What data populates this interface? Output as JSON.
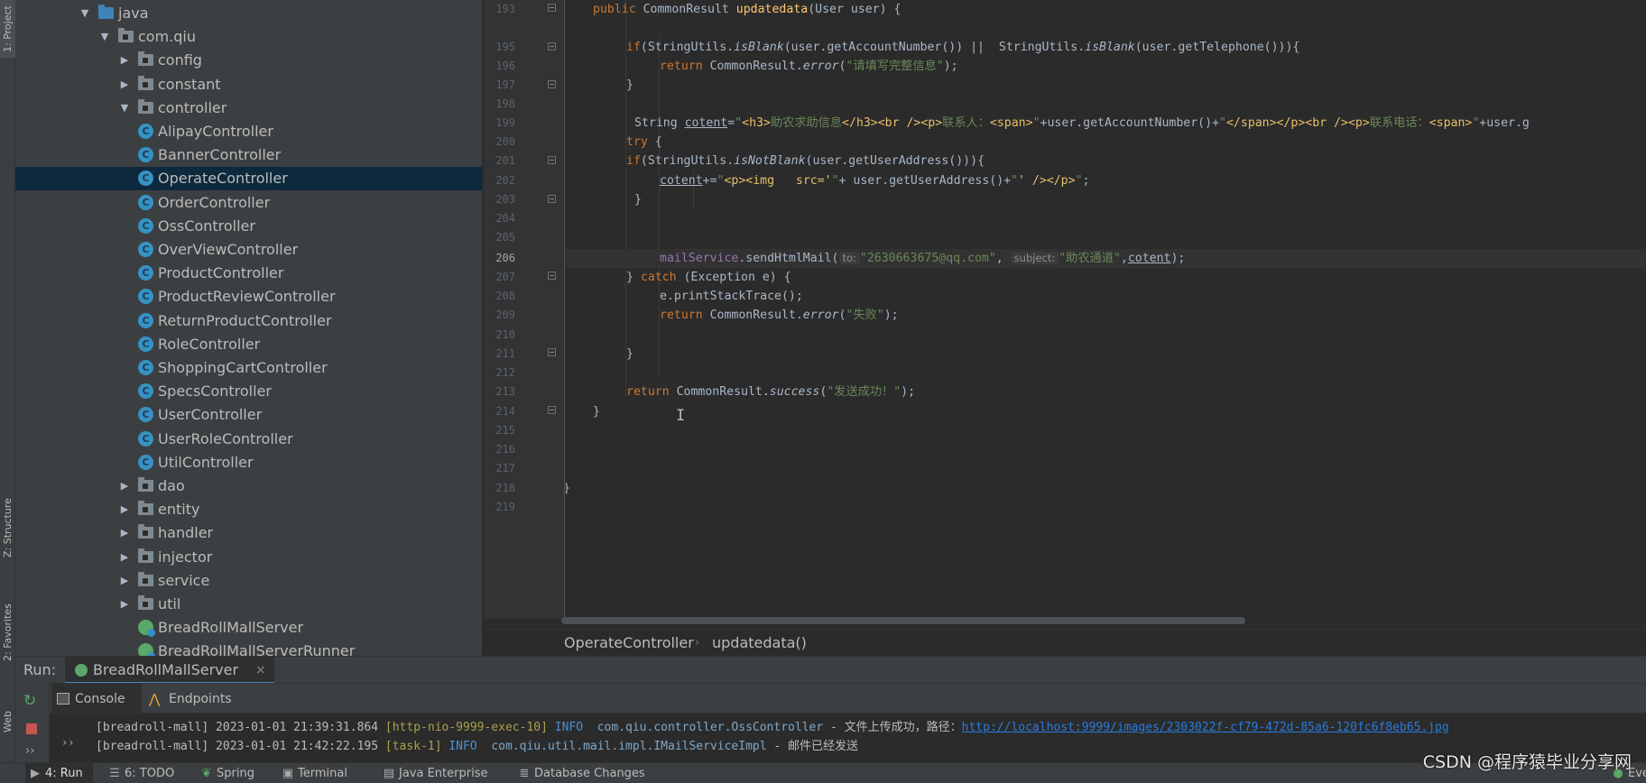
{
  "side_tabs": {
    "project": "1: Project",
    "structure": "Z: Structure",
    "favorites": "2: Favorites",
    "web": "Web"
  },
  "tree": [
    {
      "label": "java",
      "kind": "folder-blue",
      "state": "expanded"
    },
    {
      "label": "com.qiu",
      "kind": "package",
      "state": "expanded"
    },
    {
      "label": "config",
      "kind": "package",
      "state": "collapsed"
    },
    {
      "label": "constant",
      "kind": "package",
      "state": "collapsed"
    },
    {
      "label": "controller",
      "kind": "package",
      "state": "expanded"
    },
    {
      "label": "AlipayController",
      "kind": "class"
    },
    {
      "label": "BannerController",
      "kind": "class"
    },
    {
      "label": "OperateController",
      "kind": "class",
      "selected": true
    },
    {
      "label": "OrderController",
      "kind": "class"
    },
    {
      "label": "OssController",
      "kind": "class"
    },
    {
      "label": "OverViewController",
      "kind": "class"
    },
    {
      "label": "ProductController",
      "kind": "class"
    },
    {
      "label": "ProductReviewController",
      "kind": "class"
    },
    {
      "label": "ReturnProductController",
      "kind": "class"
    },
    {
      "label": "RoleController",
      "kind": "class"
    },
    {
      "label": "ShoppingCartController",
      "kind": "class"
    },
    {
      "label": "SpecsController",
      "kind": "class"
    },
    {
      "label": "UserController",
      "kind": "class"
    },
    {
      "label": "UserRoleController",
      "kind": "class"
    },
    {
      "label": "UtilController",
      "kind": "class"
    },
    {
      "label": "dao",
      "kind": "package",
      "state": "collapsed"
    },
    {
      "label": "entity",
      "kind": "package",
      "state": "collapsed"
    },
    {
      "label": "handler",
      "kind": "package",
      "state": "collapsed"
    },
    {
      "label": "injector",
      "kind": "package",
      "state": "collapsed"
    },
    {
      "label": "service",
      "kind": "package",
      "state": "collapsed"
    },
    {
      "label": "util",
      "kind": "package",
      "state": "collapsed"
    },
    {
      "label": "BreadRollMallServer",
      "kind": "spring-class"
    },
    {
      "label": "BreadRollMallServerRunner",
      "kind": "spring-class"
    }
  ],
  "line_numbers": [
    "193",
    "195",
    "196",
    "197",
    "198",
    "199",
    "200",
    "201",
    "202",
    "203",
    "204",
    "205",
    "206",
    "207",
    "208",
    "209",
    "210",
    "211",
    "212",
    "213",
    "214",
    "215",
    "216",
    "217",
    "218",
    "219"
  ],
  "code": {
    "l193": {
      "mod": "public ",
      "type": "CommonResult ",
      "fn": "updatedata",
      "params": "(User user) {"
    },
    "l195": {
      "kw": "if",
      "a": "(StringUtils.",
      "m1": "isBlank",
      "b": "(user.getAccountNumber()) ||  StringUtils.",
      "m2": "isBlank",
      "c": "(user.getTelephone())){"
    },
    "l196": {
      "kw": "return ",
      "a": "CommonResult.",
      "m": "error",
      "b": "(",
      "s": "\"请填写完整信息\"",
      "c": ");"
    },
    "l197": {
      "a": "}"
    },
    "l199": {
      "a": "String ",
      "v": "cotent",
      "eq": "=",
      "s1": "\"",
      "t1": "<h3>",
      "s2": "助农求助信息",
      "t2": "</h3><br /><p>",
      "s3": "联系人：",
      "t3": "<span>",
      "s4": "\"",
      "mid": "+user.getAccountNumber()+",
      "s5": "\"",
      "t4": "</span></p><br /><p>",
      "s6": "联系电话：",
      "t5": "<span>",
      "s7": "\"",
      "tail": "+user.g"
    },
    "l200": {
      "kw": "try ",
      "a": "{"
    },
    "l201": {
      "kw": "if",
      "a": "(StringUtils.",
      "m": "isNotBlank",
      "b": "(user.getUserAddress())){"
    },
    "l202": {
      "v": "cotent",
      "a": "+=",
      "s1": "\"",
      "t1": "<p><img   src='",
      "s2": "\"",
      "mid": "+ user.getUserAddress()+",
      "s3": "\"",
      "t2": "' /></p>",
      "s4": "\"",
      "c": ";"
    },
    "l203": {
      "a": "}"
    },
    "l206": {
      "f": "mailService",
      "a": ".sendHtmlMail(",
      "h1": "to:",
      "s1": "\"2630663675@qq.com\"",
      "b": ", ",
      "h2": "subject:",
      "s2": "\"助农通道\"",
      "c": ",",
      "v": "cotent",
      "d": ");"
    },
    "l207": {
      "a": "} ",
      "kw": "catch ",
      "b": "(Exception e) {"
    },
    "l208": {
      "a": "e.printStackTrace();"
    },
    "l209": {
      "kw": "return ",
      "a": "CommonResult.",
      "m": "error",
      "b": "(",
      "s": "\"失败\"",
      "c": ");"
    },
    "l211": {
      "a": "}"
    },
    "l213": {
      "kw": "return ",
      "a": "CommonResult.",
      "m": "success",
      "b": "(",
      "s": "\"发送成功！\"",
      "c": ");"
    },
    "l214": {
      "a": "}"
    },
    "l218": {
      "a": "}"
    }
  },
  "breadcrumb": {
    "file": "OperateController",
    "method": "updatedata()"
  },
  "run": {
    "label": "Run:",
    "config": "BreadRollMallServer",
    "tabs": {
      "console": "Console",
      "endpoints": "Endpoints"
    }
  },
  "console": [
    {
      "prefix": "[breadroll-mall] 2023-01-01 21:39:31.864 ",
      "thread": "[http-nio-9999-exec-10]",
      "level": "INFO",
      "cls": "com.qiu.controller.OssController",
      "msg": " - 文件上传成功，路径：",
      "link": "http://localhost:9999/images/2303022f-cf79-472d-85a6-120fc6f8eb65.jpg"
    },
    {
      "prefix": "[breadroll-mall] 2023-01-01 21:42:22.195 ",
      "thread": "[task-1]",
      "level": "INFO",
      "cls": "com.qiu.util.mail.impl.IMailServiceImpl",
      "msg": " - 邮件已经发送",
      "link": ""
    }
  ],
  "bottom_tabs": {
    "run": "4: Run",
    "todo": "6: TODO",
    "spring": "Spring",
    "terminal": "Terminal",
    "java_enterprise": "Java Enterprise",
    "database_changes": "Database Changes",
    "event_log": "Eve"
  },
  "watermark": "CSDN @程序猿毕业分享网",
  "colors": {
    "keyword": "#cc7832",
    "string": "#6a8759",
    "method": "#ffc66d",
    "field": "#9876aa",
    "selection": "#0d293e"
  }
}
